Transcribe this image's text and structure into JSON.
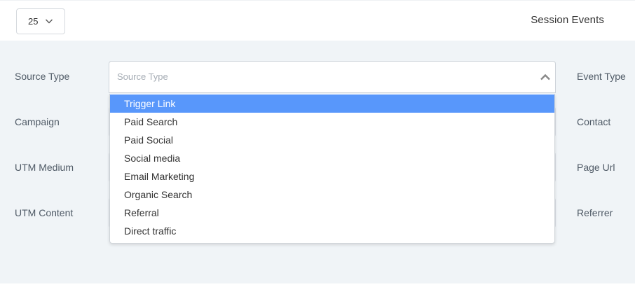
{
  "toolbar": {
    "page_size": {
      "value": "25",
      "icon": "chevron-down-icon"
    },
    "title": "Session Events"
  },
  "filters": {
    "left_labels": [
      "Source Type",
      "Campaign",
      "UTM Medium",
      "UTM Content"
    ],
    "right_labels": [
      "Event Type",
      "Contact",
      "Page Url",
      "Referrer"
    ],
    "source_type": {
      "placeholder": "Source Type",
      "icon": "chevron-up-icon",
      "options": [
        "Trigger Link",
        "Paid Search",
        "Paid Social",
        "Social media",
        "Email Marketing",
        "Organic Search",
        "Referral",
        "Direct traffic"
      ],
      "highlighted": "Trigger Link"
    }
  },
  "colors": {
    "panel_bg": "#f0f4f7",
    "highlight": "#5897fb",
    "label_text": "#4f5a66",
    "placeholder_text": "#a5acb4"
  }
}
